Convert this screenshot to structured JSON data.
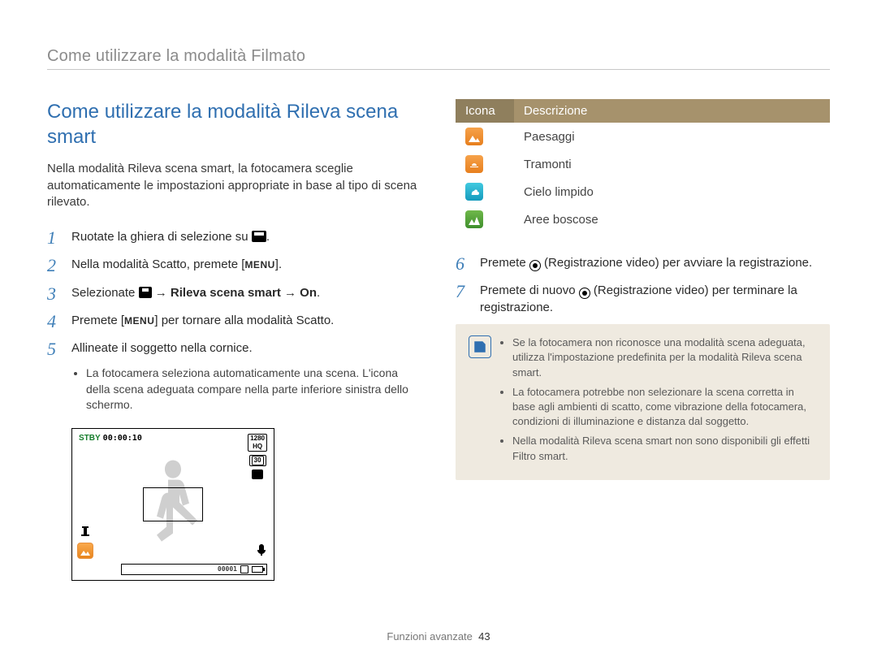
{
  "header": "Come utilizzare la modalità Filmato",
  "title": "Come utilizzare la modalità Rileva scena smart",
  "intro": "Nella modalità Rileva scena smart, la fotocamera sceglie automaticamente le impostazioni appropriate in base al tipo di scena rilevato.",
  "steps_left": [
    {
      "n": "1",
      "html": "Ruotate la ghiera di selezione su <span class='movie-icon-lg' data-name='movie-dial-icon' data-interactable='false'></span>."
    },
    {
      "n": "2",
      "html": "Nella modalità Scatto, premete [<span class='menu-box' data-name='menu-button-icon' data-interactable='false'>MENU</span>]."
    },
    {
      "n": "3",
      "html": "Selezionate <span class='movie-icon' data-name='movie-menu-icon' data-interactable='false'></span> → <strong>Rileva scena smart</strong> → <strong>On</strong>."
    },
    {
      "n": "4",
      "html": "Premete [<span class='menu-box' data-name='menu-button-icon' data-interactable='false'>MENU</span>] per tornare alla modalità Scatto."
    },
    {
      "n": "5",
      "html": "Allineate il soggetto nella cornice."
    }
  ],
  "step5_sub": "La fotocamera seleziona automaticamente una scena. L'icona della scena adeguata compare nella parte inferiore sinistra dello schermo.",
  "preview": {
    "stby": "STBY",
    "time": "00:00:10",
    "hud_res": "1280\nHQ",
    "hud_fps": "30",
    "counter": "00001"
  },
  "table": {
    "head_icon": "Icona",
    "head_desc": "Descrizione",
    "rows": [
      {
        "icon": "landscape",
        "label": "Paesaggi"
      },
      {
        "icon": "sunset",
        "label": "Tramonti"
      },
      {
        "icon": "sky",
        "label": "Cielo limpido"
      },
      {
        "icon": "forest",
        "label": "Aree boscose"
      }
    ]
  },
  "steps_right": [
    {
      "n": "6",
      "html": "Premete <span class='rec-icon' data-name='record-button-icon' data-interactable='false'></span> (Registrazione video) per avviare la registrazione."
    },
    {
      "n": "7",
      "html": "Premete di nuovo <span class='rec-icon' data-name='record-button-icon' data-interactable='false'></span> (Registrazione video) per terminare la registrazione."
    }
  ],
  "notes": [
    "Se la fotocamera non riconosce una modalità scena adeguata, utilizza l'impostazione predefinita per la modalità Rileva scena smart.",
    "La fotocamera potrebbe non selezionare la scena corretta in base agli ambienti di scatto, come vibrazione della fotocamera, condizioni di illuminazione e distanza dal soggetto.",
    "Nella modalità Rileva scena smart non sono disponibili gli effetti Filtro smart."
  ],
  "footer_section": "Funzioni avanzate",
  "footer_page": "43"
}
